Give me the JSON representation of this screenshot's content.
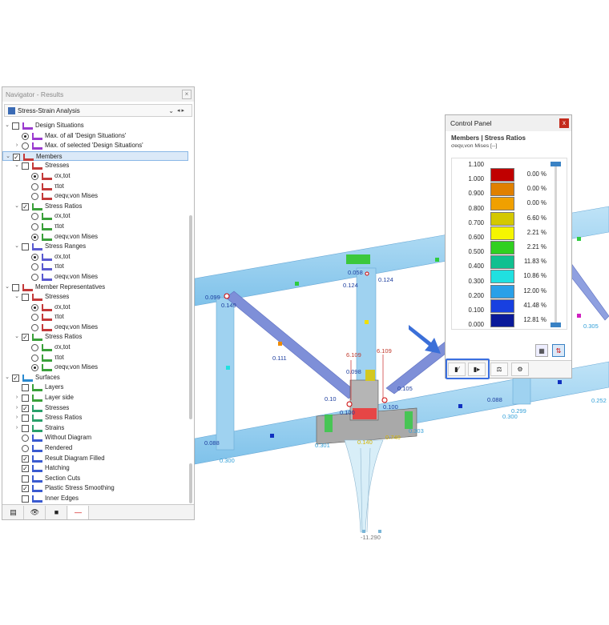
{
  "navigator": {
    "title": "Navigator - Results",
    "close": "×",
    "combo": "Stress-Strain Analysis",
    "tree": [
      {
        "label": "Design Situations",
        "level": 0,
        "exp": "v",
        "check": "cb",
        "icon": "design-situations-icon"
      },
      {
        "label": "Max. of all 'Design Situations'",
        "level": 1,
        "exp": "",
        "check": "rb-on",
        "icon": "design-situations-icon"
      },
      {
        "label": "Max. of selected 'Design Situations'",
        "level": 1,
        "exp": ">",
        "check": "rb",
        "icon": "design-situations-icon"
      },
      {
        "label": "Members",
        "level": 0,
        "exp": "v",
        "check": "cb-on",
        "icon": "members-icon",
        "selected": true
      },
      {
        "label": "Stresses",
        "level": 1,
        "exp": "v",
        "check": "cb",
        "icon": "stresses-icon"
      },
      {
        "label": "σx,tot",
        "level": 2,
        "exp": "",
        "check": "rb-on",
        "icon": "stresses-icon"
      },
      {
        "label": "τtot",
        "level": 2,
        "exp": "",
        "check": "rb",
        "icon": "stresses-icon"
      },
      {
        "label": "σeqv,von Mises",
        "level": 2,
        "exp": "",
        "check": "rb",
        "icon": "stresses-icon"
      },
      {
        "label": "Stress Ratios",
        "level": 1,
        "exp": "v",
        "check": "cb-on",
        "icon": "stress-ratios-icon"
      },
      {
        "label": "σx,tot",
        "level": 2,
        "exp": "",
        "check": "rb",
        "icon": "stress-ratios-icon"
      },
      {
        "label": "τtot",
        "level": 2,
        "exp": "",
        "check": "rb",
        "icon": "stress-ratios-icon"
      },
      {
        "label": "σeqv,von Mises",
        "level": 2,
        "exp": "",
        "check": "rb-on",
        "icon": "stress-ratios-icon"
      },
      {
        "label": "Stress Ranges",
        "level": 1,
        "exp": "v",
        "check": "cb",
        "icon": "stress-ranges-icon"
      },
      {
        "label": "σx,tot",
        "level": 2,
        "exp": "",
        "check": "rb-on",
        "icon": "stress-ranges-icon"
      },
      {
        "label": "τtot",
        "level": 2,
        "exp": "",
        "check": "rb",
        "icon": "stress-ranges-icon"
      },
      {
        "label": "σeqv,von Mises",
        "level": 2,
        "exp": "",
        "check": "rb",
        "icon": "stress-ranges-icon"
      },
      {
        "label": "Member Representatives",
        "level": 0,
        "exp": "v",
        "check": "cb",
        "icon": "members-icon"
      },
      {
        "label": "Stresses",
        "level": 1,
        "exp": "v",
        "check": "cb",
        "icon": "stresses-icon"
      },
      {
        "label": "σx,tot",
        "level": 2,
        "exp": "",
        "check": "rb-on",
        "icon": "stresses-icon"
      },
      {
        "label": "τtot",
        "level": 2,
        "exp": "",
        "check": "rb",
        "icon": "stresses-icon"
      },
      {
        "label": "σeqv,von Mises",
        "level": 2,
        "exp": "",
        "check": "rb",
        "icon": "stresses-icon"
      },
      {
        "label": "Stress Ratios",
        "level": 1,
        "exp": "v",
        "check": "cb-on",
        "icon": "stress-ratios-icon"
      },
      {
        "label": "σx,tot",
        "level": 2,
        "exp": "",
        "check": "rb",
        "icon": "stress-ratios-icon"
      },
      {
        "label": "τtot",
        "level": 2,
        "exp": "",
        "check": "rb",
        "icon": "stress-ratios-icon"
      },
      {
        "label": "σeqv,von Mises",
        "level": 2,
        "exp": "",
        "check": "rb-on",
        "icon": "stress-ratios-icon"
      },
      {
        "label": "Surfaces",
        "level": 0,
        "exp": "v",
        "check": "cb-on",
        "icon": "surfaces-icon"
      },
      {
        "label": "Layers",
        "level": 1,
        "exp": "",
        "check": "cb",
        "icon": "layers-icon"
      },
      {
        "label": "Layer side",
        "level": 1,
        "exp": ">",
        "check": "cb",
        "icon": "layers-icon"
      },
      {
        "label": "Stresses",
        "level": 1,
        "exp": ">",
        "check": "cb-on",
        "icon": "surface-stresses-icon"
      },
      {
        "label": "Stress Ratios",
        "level": 1,
        "exp": ">",
        "check": "cb",
        "icon": "surface-stresses-icon"
      },
      {
        "label": "Strains",
        "level": 1,
        "exp": ">",
        "check": "cb",
        "icon": "surface-stresses-icon"
      },
      {
        "label": "Without Diagram",
        "level": 1,
        "exp": "",
        "check": "rb",
        "icon": "diagram-icon"
      },
      {
        "label": "Rendered",
        "level": 1,
        "exp": "",
        "check": "rb",
        "icon": "diagram-icon"
      },
      {
        "label": "Result Diagram Filled",
        "level": 1,
        "exp": "",
        "check": "cb-on",
        "icon": "diagram-icon"
      },
      {
        "label": "Hatching",
        "level": 1,
        "exp": "",
        "check": "cb-on",
        "icon": "diagram-icon"
      },
      {
        "label": "Section Cuts",
        "level": 1,
        "exp": "",
        "check": "cb",
        "icon": "diagram-icon"
      },
      {
        "label": "Plastic Stress Smoothing",
        "level": 1,
        "exp": "",
        "check": "cb-on",
        "icon": "diagram-icon"
      },
      {
        "label": "Inner Edges",
        "level": 1,
        "exp": "",
        "check": "cb",
        "icon": "diagram-icon"
      }
    ],
    "tabs": [
      "data-tab-icon",
      "view-tab-icon",
      "video-tab-icon",
      "results-tab-icon"
    ]
  },
  "control_panel": {
    "title": "Control Panel",
    "close": "x",
    "subtitle": "Members | Stress Ratios",
    "symbol": "σeqv,von Mises [--]",
    "legend": [
      {
        "value": "1.100",
        "color": "",
        "percent": ""
      },
      {
        "value": "1.000",
        "color": "#c00000",
        "percent": "0.00 %"
      },
      {
        "value": "0.900",
        "color": "#e08000",
        "percent": "0.00 %"
      },
      {
        "value": "0.800",
        "color": "#f0a000",
        "percent": "0.00 %"
      },
      {
        "value": "0.700",
        "color": "#d4c800",
        "percent": "6.60 %"
      },
      {
        "value": "0.600",
        "color": "#f5f500",
        "percent": "2.21 %"
      },
      {
        "value": "0.500",
        "color": "#30d020",
        "percent": "2.21 %"
      },
      {
        "value": "0.400",
        "color": "#10c090",
        "percent": "11.83 %"
      },
      {
        "value": "0.300",
        "color": "#20e0e0",
        "percent": "10.86 %"
      },
      {
        "value": "0.200",
        "color": "#2aa0e8",
        "percent": "12.00 %"
      },
      {
        "value": "0.100",
        "color": "#1840e0",
        "percent": "41.48 %"
      },
      {
        "value": "0.000",
        "color": "#0a1a9a",
        "percent": "12.81 %"
      }
    ]
  },
  "model_labels": {
    "l1": "0.099",
    "l2": "0.149",
    "l3": "0.058",
    "l4": "0.124",
    "l5": "0.124",
    "l6": "0.111",
    "l7": "6.109",
    "l8": "6.109",
    "l9": "0.098",
    "l10": "0.10",
    "l11": "0.105",
    "l12": "0.100",
    "l13": "0.100",
    "l14": "0.088",
    "l15": "0.088",
    "l16": "0.300",
    "l17": "0.301",
    "l18": "0.140",
    "l19": "0.740",
    "l20": "0.303",
    "l21": "0.299",
    "l22": "0.300",
    "l23": "0.252",
    "l24": "0.305",
    "l25": "-11.290"
  }
}
